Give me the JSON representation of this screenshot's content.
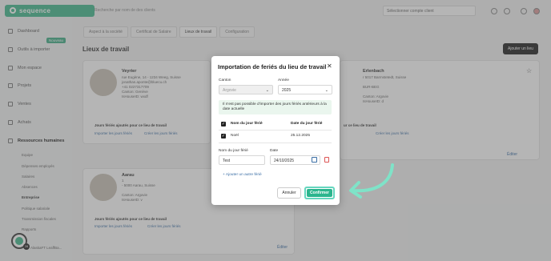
{
  "app": {
    "brand": "sequence"
  },
  "topbar": {
    "search_placeholder": "Recherche par nom de des clients",
    "company_select": "Sélectionner compte client"
  },
  "sidebar": {
    "items": [
      {
        "label": "Dashboard"
      },
      {
        "label": "Outils à importer",
        "badge": "Nouveau"
      },
      {
        "label": "Mon espace"
      },
      {
        "label": "Projets"
      },
      {
        "label": "Ventes"
      },
      {
        "label": "Achats"
      },
      {
        "label": "Ressources humaines"
      }
    ],
    "subitems": [
      "Equipe",
      "Dépenses employés",
      "Salaires",
      "Absences",
      "Entreprise",
      "Politique salariale",
      "Transmission fiscales",
      "Rapports"
    ],
    "footer_user": "AlaskaFT LeaffBa..."
  },
  "tabs": [
    "Aspect à la société",
    "Certificat de Salaire",
    "Lieux de travail",
    "Configuration"
  ],
  "page": {
    "title": "Lieux de travail",
    "add_button": "Ajouter un lieu"
  },
  "cards": [
    {
      "name": "Veyrier",
      "addr": "rue Eugène, 14 - 1234 Weeg, Suisse\njonathan.aponte@bluecu.ch\n+41 0227317709\nCanton: Genève\nIsHouseID: wxdf",
      "hol": "Jours fériés ajoutés pour ce lieu de travail",
      "import": "Importer les jours fériés",
      "add": "Créer les jours fériés",
      "edit": "Éditer"
    },
    {
      "name": "Erlenbach",
      "addr": "r 5017 Barmstetedt, Suisse\n\nBUR-BEG\n\nCanton: Argovie\nIsHouseID: d",
      "hol": "ur ce lieu de travail",
      "import": "",
      "add": "Créer les jours fériés",
      "edit": "Éditer"
    },
    {
      "name": "Aarau",
      "addr": "1\n- 5000 Aarau, Suisse\n\nCanton: Argovie\nIsHouseID: v",
      "hol": "Jours fériés ajoutés pour ce lieu de travail",
      "import": "Importer les jours fériés",
      "add": "Créer les jours fériés",
      "edit": "Éditer"
    }
  ],
  "modal": {
    "title": "Importation de feriés du lieu de travail",
    "canton_label": "Canton",
    "canton_value": "Argovie",
    "year_label": "Année",
    "year_value": "2025",
    "info": "Il n'est pas possible d'importer des jours fériés antérieurs à la date actuelle",
    "table": {
      "headers": [
        "Nom du jour férié",
        "Date du jour férié"
      ],
      "rows": [
        {
          "name": "Noël",
          "date": "25.12.2025",
          "checked": true
        }
      ]
    },
    "name_label": "Nom du jour férié",
    "name_value": "Test",
    "date_label": "Date",
    "date_value": "24/10/2025",
    "add_link": "+ Ajouter un autre férié",
    "cancel": "Annuler",
    "confirm": "Confirmer"
  },
  "help": {
    "count": "28"
  },
  "colors": {
    "brand": "#40b98c",
    "confirm": "#2bb58d",
    "confirm_outline": "#65d6be",
    "arrow": "#7fe3c8"
  }
}
